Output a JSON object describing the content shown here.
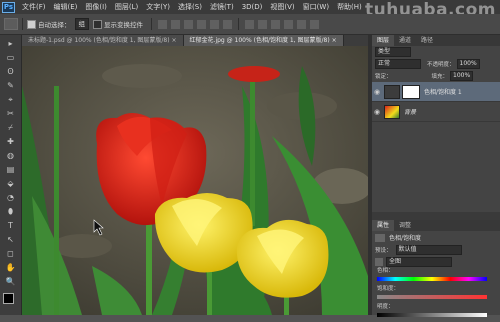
{
  "app": {
    "logo": "Ps"
  },
  "menu": [
    "文件(F)",
    "编辑(E)",
    "图像(I)",
    "图层(L)",
    "文字(Y)",
    "选择(S)",
    "滤镜(T)",
    "3D(D)",
    "视图(V)",
    "窗口(W)",
    "帮助(H)"
  ],
  "watermark": "tuhuaba.com",
  "options": {
    "auto_select_label": "自动选择：",
    "auto_select_value": "组",
    "show_transform_label": "显示变换控件"
  },
  "tabs": [
    {
      "label": "未标题-1.psd @ 100% (色相/饱和度 1, 图层蒙版/8) ×",
      "active": false
    },
    {
      "label": "红郁金花.jpg @ 100% (色相/饱和度 1, 图层蒙版/8) ×",
      "active": true
    }
  ],
  "toolbox": [
    "▸",
    "▭",
    "ʘ",
    "✎",
    "⌖",
    "✂",
    "⌿",
    "✚",
    "◍",
    "▤",
    "⬙",
    "◔",
    "⬮",
    "T",
    "↖",
    "◻",
    "✋",
    "🔍"
  ],
  "layers_panel": {
    "tabs": [
      "图层",
      "通道",
      "路径"
    ],
    "kind": "类型",
    "blend_mode": "正常",
    "opacity_label": "不透明度：",
    "opacity_value": "100%",
    "lock_label": "锁定：",
    "fill_label": "填充：",
    "fill_value": "100%",
    "layers": [
      {
        "name": "色相/饱和度 1",
        "selected": true
      },
      {
        "name": "背景",
        "selected": false
      }
    ]
  },
  "properties_panel": {
    "tabs": [
      "属性",
      "调整"
    ],
    "title": "色相/饱和度",
    "preset_label": "预设：",
    "preset_value": "默认值",
    "channel_value": "全图",
    "sliders": [
      {
        "label": "色相：",
        "value": "0"
      },
      {
        "label": "饱和度：",
        "value": "0"
      },
      {
        "label": "明度：",
        "value": "0"
      }
    ]
  },
  "colors": {
    "accent": "#5d6a7a",
    "tulip_red": "#d8231a",
    "tulip_yellow": "#f2dc1c"
  }
}
